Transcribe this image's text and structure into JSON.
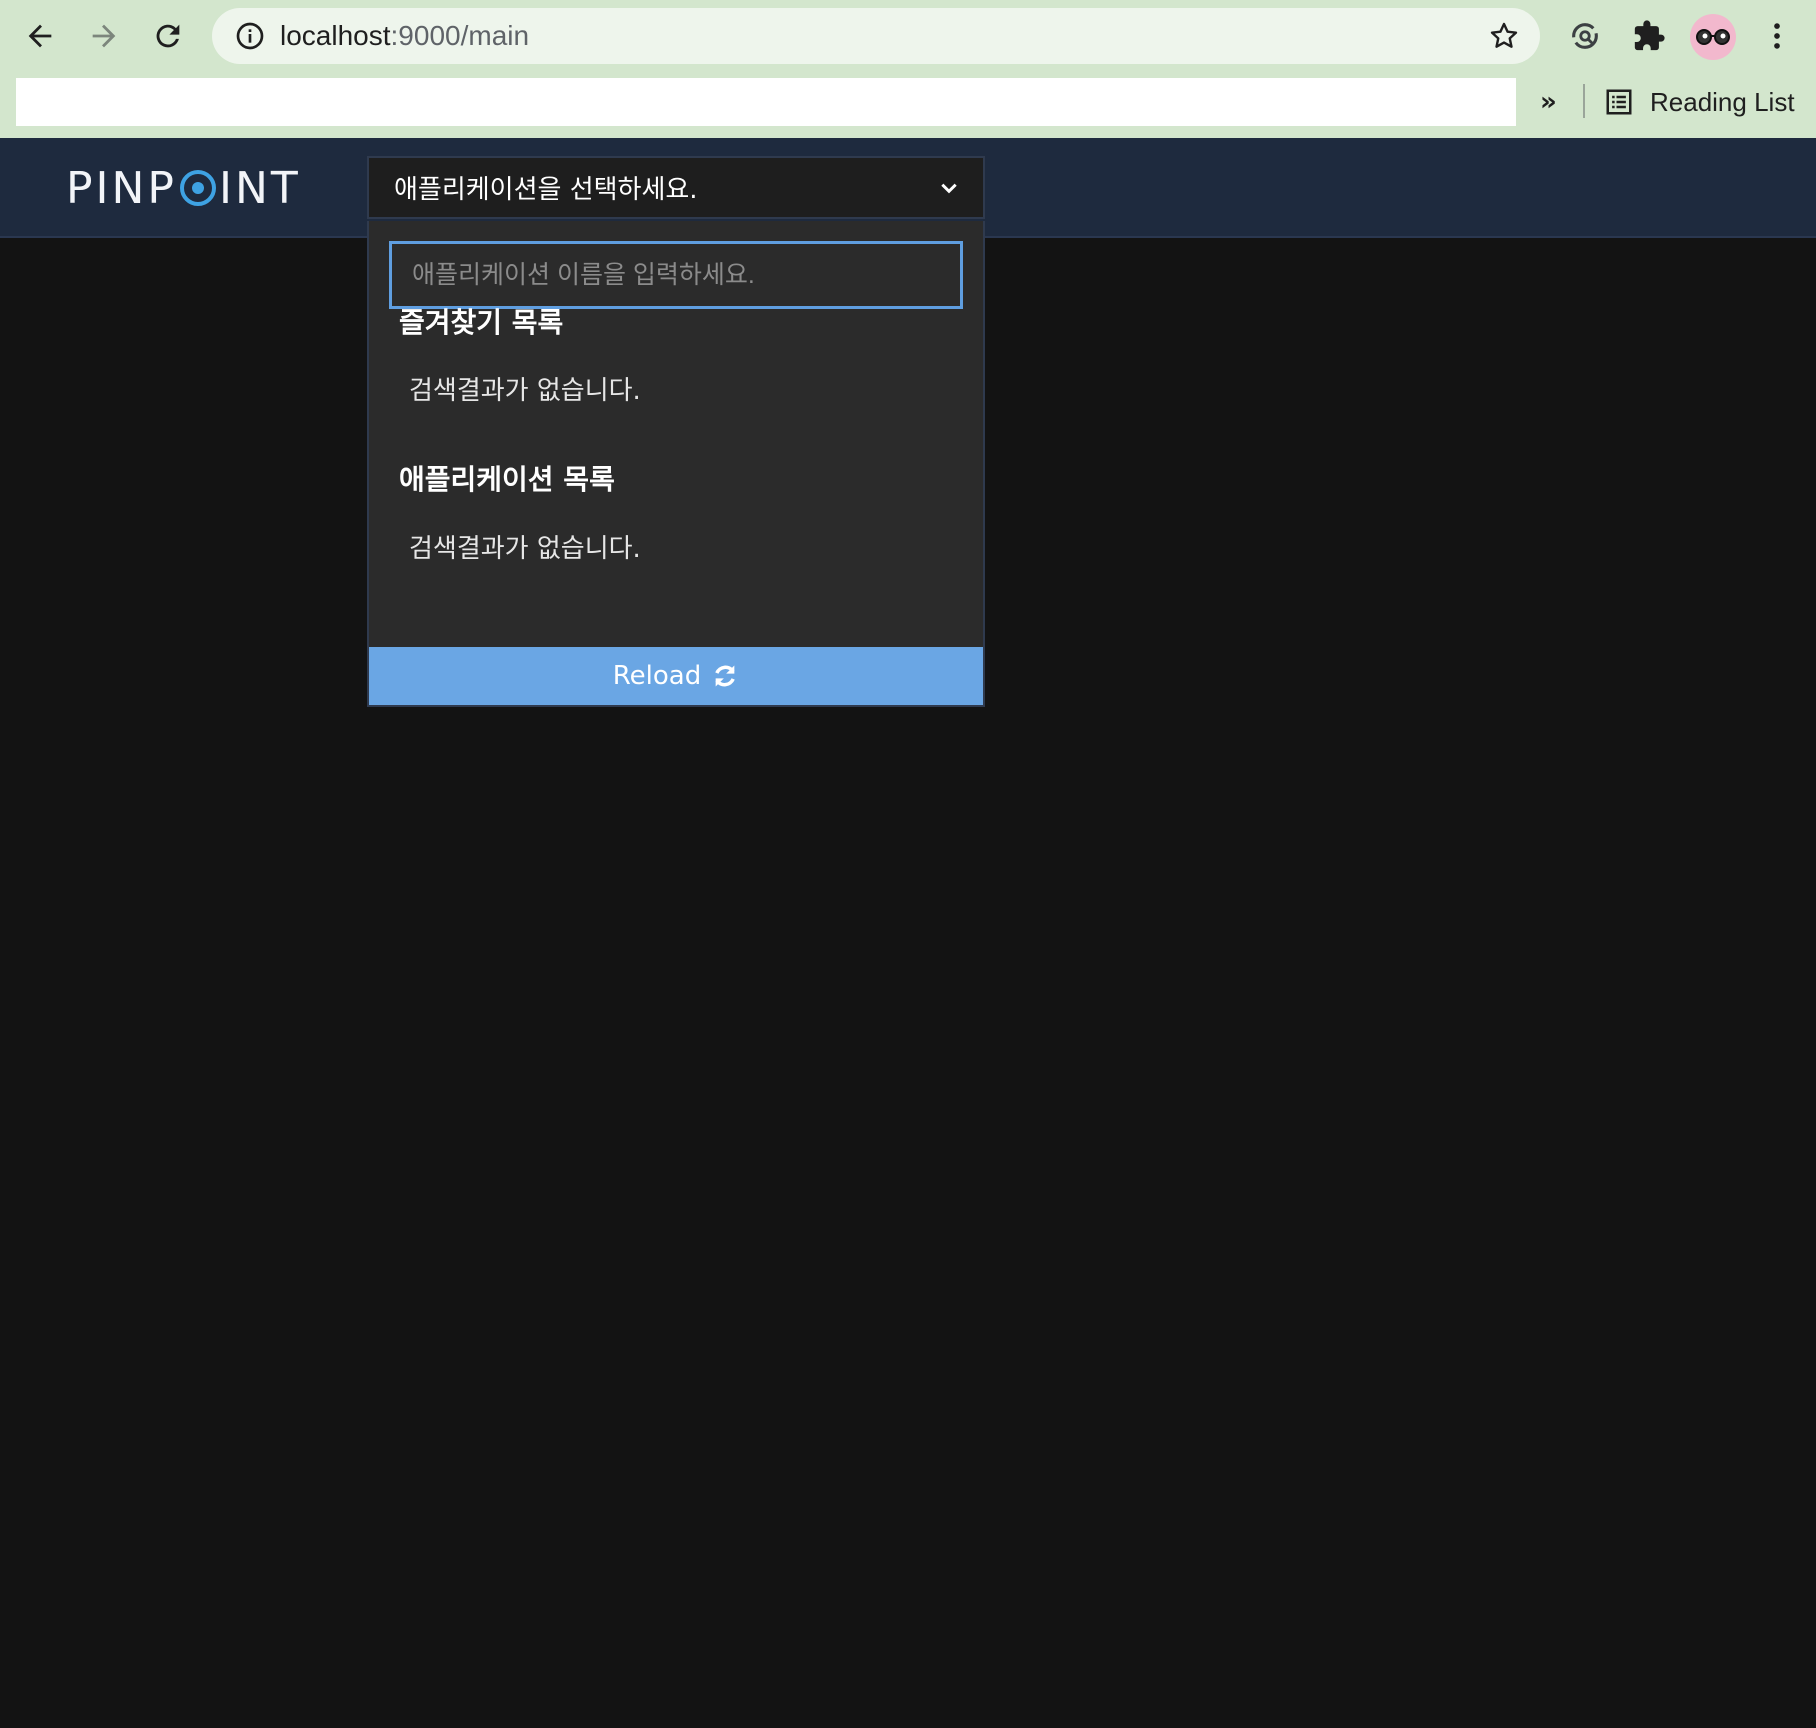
{
  "browser": {
    "url_host": "localhost",
    "url_rest": ":9000/main",
    "reading_list_label": "Reading List",
    "bookmarks_overflow": "»"
  },
  "app": {
    "logo_prefix": "PINP",
    "logo_suffix": "INT",
    "selector_placeholder": "애플리케이션을 선택하세요.",
    "search_placeholder": "애플리케이션 이름을 입력하세요.",
    "search_value": "",
    "favorites_title": "즐겨찾기 목록",
    "favorites_empty": "검색결과가 없습니다.",
    "apps_title": "애플리케이션 목록",
    "apps_empty": "검색결과가 없습니다.",
    "reload_label": "Reload"
  },
  "colors": {
    "chrome_bg": "#d3e6cd",
    "header_bg": "#1e2a3e",
    "page_bg": "#131313",
    "dropdown_bg": "#2b2b2b",
    "accent": "#6aa6e4",
    "logo_accent": "#3ea2e3"
  },
  "icons": [
    "back-arrow-icon",
    "forward-arrow-icon",
    "reload-page-icon",
    "site-info-icon",
    "bookmark-star-icon",
    "sync-icon",
    "extensions-icon",
    "profile-avatar-icon",
    "more-menu-icon",
    "reading-list-icon",
    "chevron-down-icon",
    "refresh-icon"
  ]
}
